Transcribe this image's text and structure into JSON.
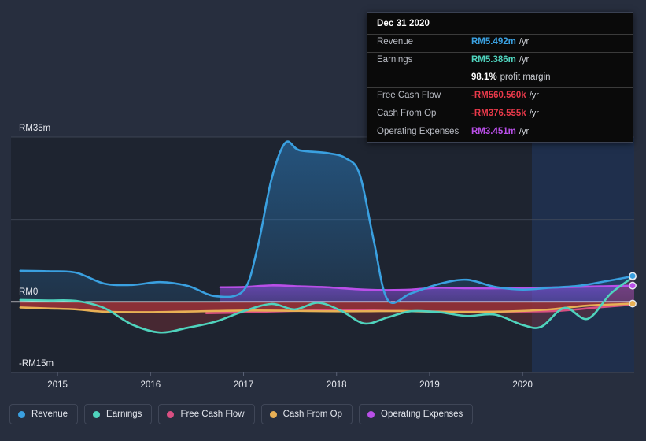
{
  "tooltip": {
    "date": "Dec 31 2020",
    "rows": [
      {
        "key": "Revenue",
        "value": "RM5.492m",
        "unit": "/yr",
        "color": "#3aa0e0"
      },
      {
        "key": "Earnings",
        "value": "RM5.386m",
        "unit": "/yr",
        "color": "#4fd3bd"
      },
      {
        "key": "",
        "value": "98.1%",
        "unit": "profit margin",
        "color": "#ffffff"
      },
      {
        "key": "Free Cash Flow",
        "value": "-RM560.560k",
        "unit": "/yr",
        "color": "#e8394a"
      },
      {
        "key": "Cash From Op",
        "value": "-RM376.555k",
        "unit": "/yr",
        "color": "#e8394a"
      },
      {
        "key": "Operating Expenses",
        "value": "RM3.451m",
        "unit": "/yr",
        "color": "#b94fe8"
      }
    ]
  },
  "legend": {
    "items": [
      {
        "label": "Revenue",
        "color": "#3aa0e0"
      },
      {
        "label": "Earnings",
        "color": "#4fd3bd"
      },
      {
        "label": "Free Cash Flow",
        "color": "#d94f82"
      },
      {
        "label": "Cash From Op",
        "color": "#e5a košt"
      },
      {
        "label": "Operating Expenses",
        "color": "#b94fe8"
      }
    ]
  },
  "chart_data": {
    "type": "area",
    "title": "",
    "xlabel": "",
    "ylabel": "",
    "currency": "RM",
    "ylim": [
      -15,
      35
    ],
    "yticks": [
      -15,
      0,
      35
    ],
    "ytick_labels": [
      "-RM15m",
      "RM0",
      "RM35m"
    ],
    "gridlines": [
      35,
      17.5,
      0,
      -15
    ],
    "zero_line": 0,
    "xlim": [
      "2014.5",
      "2021.2"
    ],
    "xticks": [
      2015,
      2016,
      2017,
      2018,
      2019,
      2020
    ],
    "xtick_labels": [
      "2015",
      "2016",
      "2017",
      "2018",
      "2019",
      "2020"
    ],
    "forecast_band": {
      "start": 2020.1,
      "end": 2021.2
    },
    "legend_position": "bottom-left",
    "grid": true,
    "series": [
      {
        "name": "Revenue",
        "color": "#3aa0e0",
        "fill": true,
        "x": [
          2014.6,
          2014.9,
          2015.2,
          2015.5,
          2015.8,
          2016.1,
          2016.4,
          2016.7,
          2017.0,
          2017.15,
          2017.3,
          2017.45,
          2017.6,
          2017.9,
          2018.1,
          2018.25,
          2018.4,
          2018.55,
          2018.8,
          2019.1,
          2019.4,
          2019.7,
          2020.0,
          2020.3,
          2020.6,
          2020.9,
          2021.2
        ],
        "values": [
          6.6,
          6.5,
          6.2,
          3.9,
          3.6,
          4.2,
          3.4,
          1.2,
          2.4,
          11.5,
          26.0,
          33.8,
          32.2,
          31.6,
          30.5,
          27.0,
          13.0,
          0.4,
          1.8,
          3.8,
          4.7,
          3.2,
          2.6,
          3.0,
          3.4,
          4.4,
          5.49
        ]
      },
      {
        "name": "Earnings",
        "color": "#4fd3bd",
        "fill": false,
        "x": [
          2014.6,
          2014.9,
          2015.2,
          2015.5,
          2015.8,
          2016.1,
          2016.4,
          2016.7,
          2017.0,
          2017.3,
          2017.55,
          2017.8,
          2018.05,
          2018.3,
          2018.55,
          2018.8,
          2019.1,
          2019.4,
          2019.7,
          2020.0,
          2020.2,
          2020.45,
          2020.7,
          2020.95,
          2021.2
        ],
        "values": [
          0.4,
          0.3,
          0.2,
          -1.3,
          -4.8,
          -6.5,
          -5.5,
          -4.2,
          -2.0,
          -0.45,
          -1.6,
          -0.2,
          -1.9,
          -4.6,
          -3.3,
          -2.0,
          -2.2,
          -3.0,
          -2.7,
          -4.9,
          -5.3,
          -1.3,
          -3.6,
          1.8,
          5.39
        ]
      },
      {
        "name": "Free Cash Flow",
        "color": "#d94f82",
        "fill": false,
        "x": [
          2016.6,
          2016.9,
          2017.2,
          2017.6,
          2018.0,
          2018.4,
          2018.8,
          2019.2,
          2019.6,
          2020.0,
          2020.4,
          2020.8,
          2021.2
        ],
        "values": [
          -2.4,
          -2.3,
          -2.1,
          -1.9,
          -1.75,
          -1.85,
          -2.0,
          -2.1,
          -2.1,
          -2.05,
          -1.9,
          -1.2,
          -0.56
        ]
      },
      {
        "name": "Cash From Op",
        "color": "#e8b055",
        "fill": false,
        "x": [
          2014.6,
          2014.9,
          2015.2,
          2015.5,
          2015.9,
          2016.3,
          2016.7,
          2017.1,
          2017.5,
          2017.9,
          2018.3,
          2018.7,
          2019.1,
          2019.5,
          2019.9,
          2020.3,
          2020.7,
          2021.2
        ],
        "values": [
          -1.2,
          -1.4,
          -1.6,
          -2.1,
          -2.2,
          -2.1,
          -1.95,
          -1.85,
          -1.9,
          -2.0,
          -2.0,
          -1.95,
          -2.1,
          -2.15,
          -2.0,
          -1.6,
          -0.8,
          -0.38
        ]
      },
      {
        "name": "Operating Expenses",
        "color": "#b94fe8",
        "fill": true,
        "x": [
          2016.75,
          2017.0,
          2017.3,
          2017.6,
          2017.9,
          2018.2,
          2018.5,
          2018.8,
          2019.1,
          2019.4,
          2019.8,
          2020.2,
          2020.6,
          2021.2
        ],
        "values": [
          3.1,
          3.15,
          3.5,
          3.3,
          3.1,
          2.7,
          2.5,
          2.6,
          3.0,
          2.9,
          2.9,
          3.0,
          3.2,
          3.45
        ]
      }
    ],
    "endpoint_markers": [
      {
        "series": "Earnings",
        "value": 5.386,
        "color": "#4fd3bd"
      },
      {
        "series": "Revenue",
        "value": 5.492,
        "color": "#3aa0e0"
      },
      {
        "series": "Operating Expenses",
        "value": 3.451,
        "color": "#b94fe8"
      },
      {
        "series": "Cash From Op",
        "value": -0.376,
        "color": "#e8b055"
      }
    ]
  },
  "colors": {
    "background": "#272e3e",
    "plot_background": "#1e2430",
    "forecast_band": "#1b2a44",
    "grid": "#454c5c",
    "zero_line": "#ffffff",
    "negative_fill": "#a8353a"
  }
}
